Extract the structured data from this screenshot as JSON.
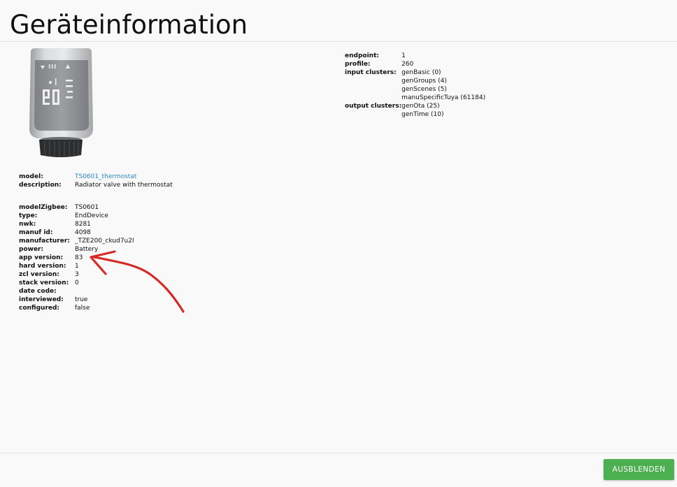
{
  "dialog": {
    "title": "Geräteinformation",
    "hide_button_label": "AUSBLENDEN"
  },
  "device": {
    "model_label": "model:",
    "model_value": "TS0601_thermostat",
    "description_label": "description:",
    "description_value": "Radiator valve with thermostat"
  },
  "details": [
    {
      "label": "modelZigbee:",
      "value": "TS0601"
    },
    {
      "label": "type:",
      "value": "EndDevice"
    },
    {
      "label": "nwk:",
      "value": "8281"
    },
    {
      "label": "manuf id:",
      "value": "4098"
    },
    {
      "label": "manufacturer:",
      "value": "_TZE200_ckud7u2l"
    },
    {
      "label": "power:",
      "value": "Battery"
    },
    {
      "label": "app version:",
      "value": "83"
    },
    {
      "label": "hard version:",
      "value": "1"
    },
    {
      "label": "zcl version:",
      "value": "3"
    },
    {
      "label": "stack version:",
      "value": "0"
    },
    {
      "label": "date code:",
      "value": ""
    },
    {
      "label": "interviewed:",
      "value": "true"
    },
    {
      "label": "configured:",
      "value": "false"
    }
  ],
  "endpoint": {
    "endpoint_label": "endpoint:",
    "endpoint_value": "1",
    "profile_label": "profile:",
    "profile_value": "260",
    "input_clusters_label": "input clusters:",
    "input_clusters": [
      "genBasic (0)",
      "genGroups (4)",
      "genScenes (5)",
      "manuSpecificTuya (61184)"
    ],
    "output_clusters_label": "output clusters:",
    "output_clusters": [
      "genOta (25)",
      "genTime (10)"
    ]
  },
  "colors": {
    "accent_button": "#4caf50",
    "link": "#2a87c8",
    "annotation_arrow": "#d62a26"
  }
}
